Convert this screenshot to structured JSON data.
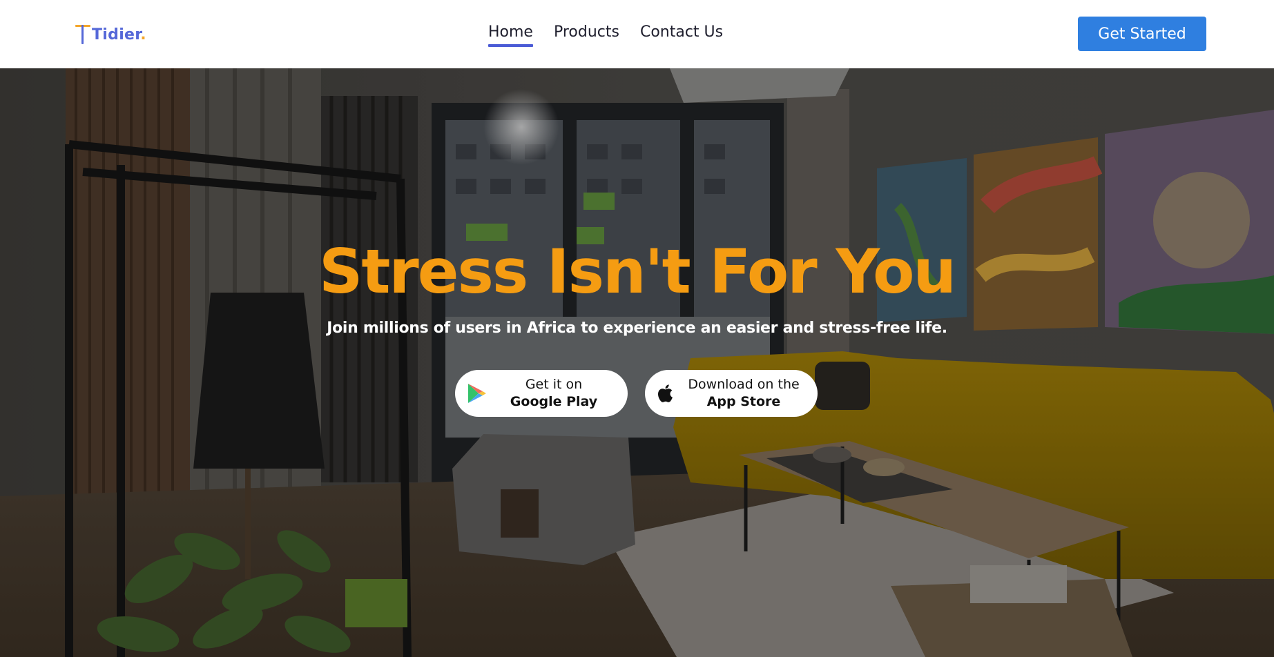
{
  "header": {
    "logo_text": "Tidier",
    "logo_dot": ".",
    "nav": [
      {
        "label": "Home",
        "active": true
      },
      {
        "label": "Products",
        "active": false
      },
      {
        "label": "Contact Us",
        "active": false
      }
    ],
    "cta_label": "Get Started"
  },
  "hero": {
    "title": "Stress Isn't For You",
    "subtitle": "Join millions of users in Africa to experience an easier and stress-free life.",
    "buttons": {
      "google_play": {
        "line1": "Get it on",
        "line2": "Google Play",
        "icon": "google-play-icon"
      },
      "app_store": {
        "line1": "Download on the",
        "line2": "App Store",
        "icon": "apple-icon"
      }
    },
    "background": "living-room-photo"
  },
  "colors": {
    "brand_blue": "#5568d8",
    "brand_orange": "#f4a62a",
    "title_orange": "#f59c12",
    "cta_blue": "#2f7fe0",
    "nav_underline": "#4a5bd6"
  }
}
